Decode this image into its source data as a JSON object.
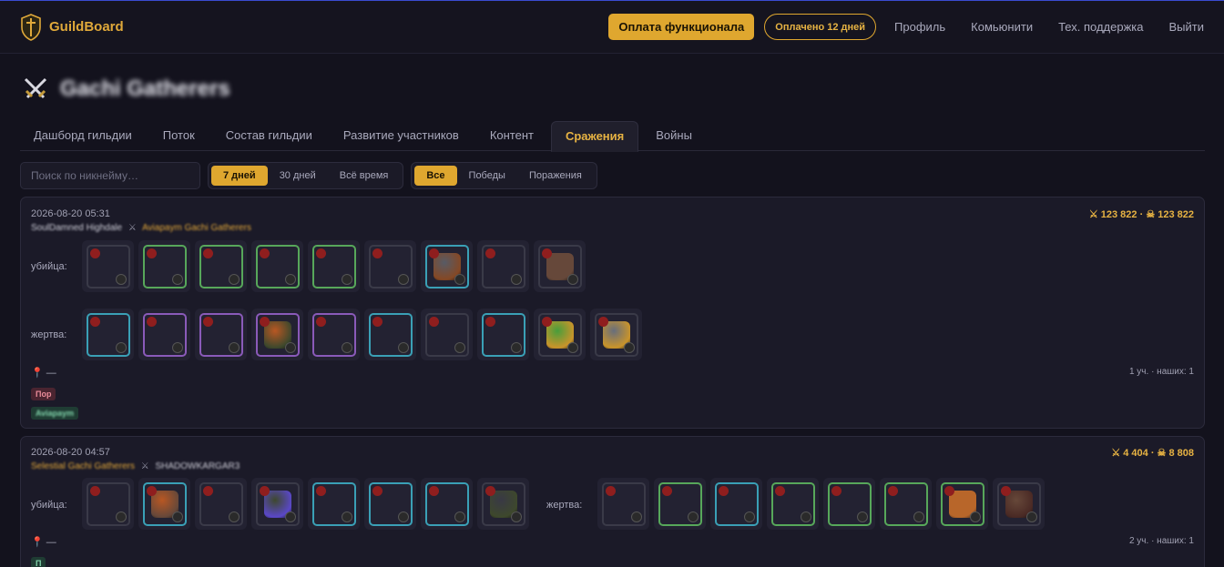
{
  "app": {
    "logo_text": "GuildBoard"
  },
  "nav": {
    "pay_button": "Оплата функционала",
    "paid_badge": "Оплачено 12 дней",
    "links": [
      "Профиль",
      "Комьюнити",
      "Тех. поддержка",
      "Выйти"
    ]
  },
  "guild": {
    "name": "Gachi Gatherers"
  },
  "tabs": [
    "Дашборд гильдии",
    "Поток",
    "Состав гильдии",
    "Развитие участников",
    "Контент",
    "Сражения",
    "Войны"
  ],
  "active_tab": "Сражения",
  "filters": {
    "search_placeholder": "Поиск по никнейму…",
    "period": [
      "7 дней",
      "30 дней",
      "Всё время"
    ],
    "result": [
      "Все",
      "Победы",
      "Поражения"
    ]
  },
  "labels": {
    "killer": "убийца:",
    "victim": "жертва:"
  },
  "battles": [
    {
      "date": "2026-08-20 05:31",
      "killer_name": "SoulDamned",
      "killer_guild": "Highdale",
      "victim_name": "Aviapaym",
      "victim_guild": "Gachi Gatherers",
      "fame": "⚔ 123 822 · ☠ 123 822",
      "location": "—",
      "summary": "1 уч. · наших: 1",
      "result_badge": "Пор",
      "player_badge": "Aviapaym",
      "killer_items": [
        "leather-hood",
        "plate-helmet",
        "plate-boots",
        "fire-staff",
        "plate-armor",
        "green-potion",
        "frost-staff",
        "food-stew",
        "bear-mount"
      ],
      "victim_items": [
        "leather-hood",
        "plate-helmet",
        "plate-boots",
        "axe",
        "leather-jacket",
        "shield",
        "flame-potion",
        "sickle",
        "food-pie",
        "boar-mount"
      ]
    },
    {
      "date": "2026-08-20 04:57",
      "killer_name": "Selestial",
      "killer_guild": "Gachi Gatherers",
      "victim_name": "SHADOWKARGAR3",
      "victim_guild": "",
      "fame": "⚔ 4 404 · ☠ 8 808",
      "location": "—",
      "summary": "2 уч. · наших: 1",
      "result_badge": "П",
      "killer_items": [
        "leather-hood",
        "cursed-staff",
        "leather-boots",
        "sword",
        "leather-jacket",
        "fire-ring",
        "bloodletter",
        "panther-mount"
      ],
      "victim_items": [
        "leather-hood",
        "leather-cape",
        "leather-boots",
        "hammer",
        "leather-armor",
        "shield",
        "cloak",
        "ox-mount"
      ]
    }
  ]
}
